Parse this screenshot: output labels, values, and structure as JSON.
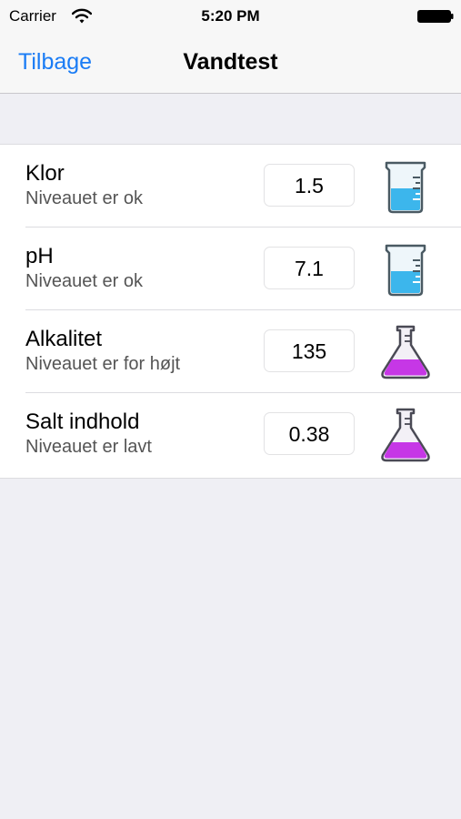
{
  "status_bar": {
    "carrier": "Carrier",
    "time": "5:20 PM",
    "wifi_icon": "wifi-icon",
    "battery_icon": "battery-icon"
  },
  "nav": {
    "back_label": "Tilbage",
    "title": "Vandtest"
  },
  "colors": {
    "accent": "#1a7cf5",
    "beaker_liquid": "#3cb6ec",
    "flask_liquid": "#c637e6"
  },
  "rows": [
    {
      "title": "Klor",
      "subtitle": "Niveauet er ok",
      "value": "1.5",
      "icon": "beaker-icon"
    },
    {
      "title": "pH",
      "subtitle": "Niveauet er ok",
      "value": "7.1",
      "icon": "beaker-icon"
    },
    {
      "title": "Alkalitet",
      "subtitle": "Niveauet er for højt",
      "value": "135",
      "icon": "flask-icon"
    },
    {
      "title": "Salt indhold",
      "subtitle": "Niveauet er lavt",
      "value": "0.38",
      "icon": "flask-icon"
    }
  ]
}
